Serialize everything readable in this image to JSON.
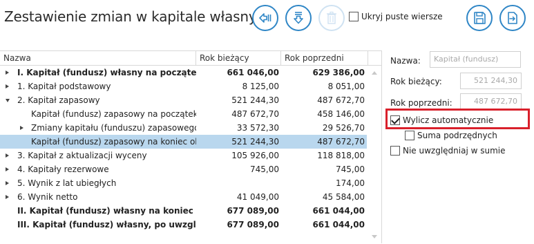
{
  "header": {
    "title": "Zestawienie zmian w kapitale własnym",
    "hide_empty_label": "Ukryj puste wiersze",
    "hide_empty_checked": false
  },
  "toolbar": {
    "import_icon": "import-icon",
    "download_icon": "download-icon",
    "delete_icon": "trash-icon",
    "save_icon": "save-icon",
    "export_icon": "export-icon"
  },
  "grid": {
    "columns": [
      "Nazwa",
      "Rok bieżący",
      "Rok poprzedni"
    ],
    "rows": [
      {
        "name": "I. Kapitał (fundusz) własny na początek okr...",
        "current": "661 046,00",
        "previous": "629 386,00",
        "bold": true,
        "expander": "collapsed",
        "level": 0
      },
      {
        "name": "1. Kapitał podstawowy",
        "current": "8 125,00",
        "previous": "8 051,00",
        "bold": false,
        "expander": "collapsed",
        "level": 0
      },
      {
        "name": "2. Kapitał zapasowy",
        "current": "521 244,30",
        "previous": "487 672,70",
        "bold": false,
        "expander": "expanded",
        "level": 0
      },
      {
        "name": "Kapitał (fundusz) zapasowy na początek ok...",
        "current": "487 672,70",
        "previous": "458 146,00",
        "bold": false,
        "expander": "none",
        "level": 1
      },
      {
        "name": "Zmiany kapitału (funduszu) zapasowego",
        "current": "33 572,30",
        "previous": "29 526,70",
        "bold": false,
        "expander": "collapsed",
        "level": 1
      },
      {
        "name": "Kapitał (fundusz) zapasowy na koniec okresu",
        "current": "521 244,30",
        "previous": "487 672,70",
        "bold": false,
        "expander": "none",
        "level": 1,
        "selected": true
      },
      {
        "name": "3. Kapitał z aktualizacji wyceny",
        "current": "105 926,00",
        "previous": "118 818,00",
        "bold": false,
        "expander": "collapsed",
        "level": 0
      },
      {
        "name": "4. Kapitały rezerwowe",
        "current": "745,00",
        "previous": "745,00",
        "bold": false,
        "expander": "collapsed",
        "level": 0
      },
      {
        "name": "5. Wynik z lat ubiegłych",
        "current": "",
        "previous": "174,00",
        "bold": false,
        "expander": "collapsed",
        "level": 0
      },
      {
        "name": "6. Wynik netto",
        "current": "41 049,00",
        "previous": "45 584,00",
        "bold": false,
        "expander": "collapsed",
        "level": 0
      },
      {
        "name": "II. Kapitał (fundusz) własny na koniec okres...",
        "current": "677 089,00",
        "previous": "661 044,00",
        "bold": true,
        "expander": "none",
        "level": 0
      },
      {
        "name": "III. Kapitał (fundusz) własny, po uwzględnie...",
        "current": "677 089,00",
        "previous": "661 044,00",
        "bold": true,
        "expander": "none",
        "level": 0
      }
    ]
  },
  "side": {
    "name_label": "Nazwa:",
    "name_value": "Kapitał (fundusz)",
    "current_label": "Rok bieżący:",
    "current_value": "521 244,30",
    "previous_label": "Rok poprzedni:",
    "previous_value": "487 672,70",
    "auto_calc_label": "Wylicz automatycznie",
    "auto_calc_checked": true,
    "sub_sum_label": "Suma podrzędnych",
    "sub_sum_checked": false,
    "exclude_label": "Nie uwzględniaj w sumie",
    "exclude_checked": false
  },
  "colors": {
    "accent": "#2f86c6",
    "selection": "#b9d7ee",
    "highlight_frame": "#d9202b"
  }
}
